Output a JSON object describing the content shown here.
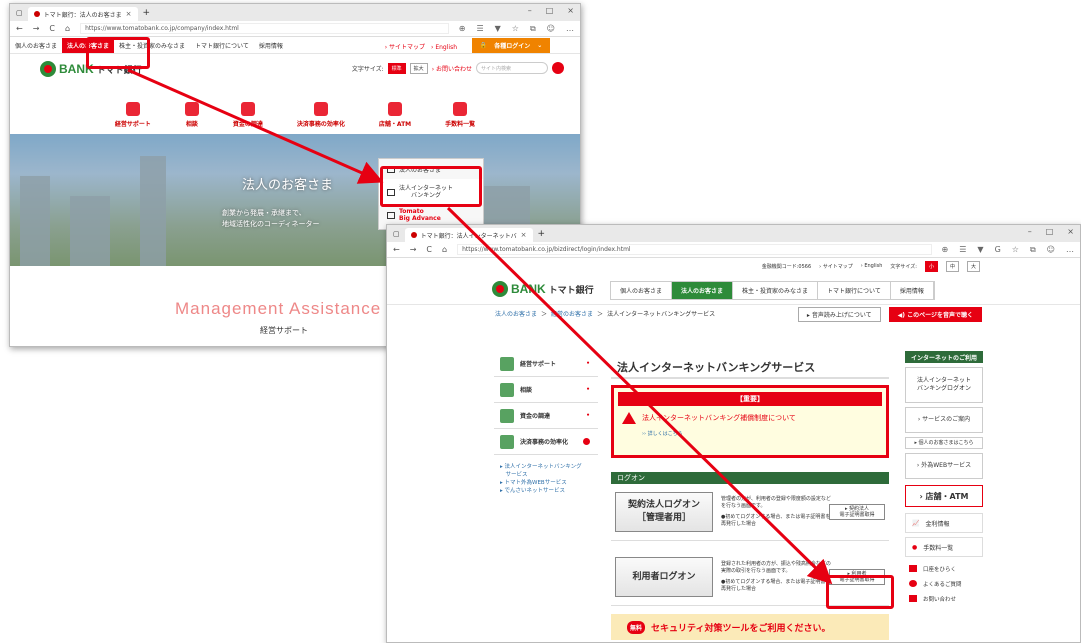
{
  "window1": {
    "tab_title": "トマト銀行：法人のお客さま",
    "url": "https://www.tomatobank.co.jp/company/index.html",
    "gnav": [
      "個人のお客さま",
      "法人のお客さま",
      "株主・投資家のみなさま",
      "トマト銀行について",
      "採用情報"
    ],
    "gnav_active": "法人のお客さま",
    "links": "› サイトマップ　› English",
    "login": "各種ログイン",
    "logo_brand": "BANK",
    "logo_name": "トマト銀行",
    "font_size_label": "文字サイズ:",
    "font_size_options": [
      "標準",
      "拡大"
    ],
    "contact": "› お問い合わせ",
    "search_placeholder": "サイト内検索",
    "categories": [
      "経営サポート",
      "相談",
      "資金の調達",
      "決済事務の効率化",
      "店舗・ATM",
      "手数料一覧"
    ],
    "hero_title": "法人のお客さま",
    "hero_sub": "創業から発展・承継まで、\n地域活性化のコーディネーター",
    "dropdown": [
      "法人のお客さま",
      "法人インターネット\nバンキング",
      "Tomato\nBig Advance"
    ],
    "section_en": "Management Assistance",
    "section_ja": "経営サポート"
  },
  "window2": {
    "tab_title": "トマト銀行：法人インターネットバ",
    "url": "https://www.tomatobank.co.jp/bizdirect/login/index.html",
    "topbar": [
      "金融機関コード:0566",
      "› サイトマップ",
      "› English",
      "文字サイズ:",
      "小",
      "中",
      "大"
    ],
    "logo_brand": "BANK",
    "logo_name": "トマト銀行",
    "gnav": [
      "個人のお客さま",
      "法人のお客さま",
      "株主・投資家のみなさま",
      "トマト銀行について",
      "採用情報"
    ],
    "gnav_active": "法人のお客さま",
    "breadcrumb": [
      "法人のお客さま",
      "＞",
      "経営のお客さま",
      "＞",
      "法人インターネットバンキングサービス"
    ],
    "audio_btn": "▸ 音声読み上げについて",
    "voice_btn": "このページを音声で聴く",
    "side_items": [
      "経営サポート",
      "相談",
      "資金の調達",
      "決済事務の効率化"
    ],
    "side_sub": [
      "▸ 法人インターネットバンキング",
      "　サービス",
      "▸ トマト外為WEBサービス",
      "▸ でんさいネットサービス"
    ],
    "page_title": "法人インターネットバンキングサービス",
    "important": "【重要】",
    "warning": "法人インターネットバンキング補償制度について",
    "more": "›› 詳しくはこちら",
    "logon_label": "ログオン",
    "contract_login": "契約法人ログオン",
    "contract_login_sub": "［管理者用］",
    "contract_desc": "管理者の方が、利用者の登録や限度額の設定などを行なう画面です。",
    "contract_note": "●初めてログオンする場合、または電子証明書を再発行した場合",
    "contract_cert": "▸ 契約法人\n電子証明書取得",
    "user_login": "利用者ログオン",
    "user_desc": "登録された利用者の方が、振込や残高照会などの実際の取引を行なう画面です。",
    "user_note": "●初めてログオンする場合、または電子証明書を再発行した場合",
    "user_cert": "▸ 利用者\n電子証明書取得",
    "free": "無料",
    "security": "セキュリティ対策ツールをご利用ください。",
    "right_head": "インターネットのご利用",
    "right_items": [
      "法人インターネット\nバンキングログオン",
      "› サービスのご案内",
      "▸ 個人のお客さまはこちら",
      "› 外為WEBサービス"
    ],
    "atm": "› 店舗・ATM",
    "rate": "金利情報",
    "fee": "手数料一覧",
    "right_list": [
      "口座をひらく",
      "よくあるご質問",
      "お問い合わせ"
    ]
  },
  "colors": {
    "accent": "#e60012",
    "brand_green": "#2e8b3a"
  }
}
